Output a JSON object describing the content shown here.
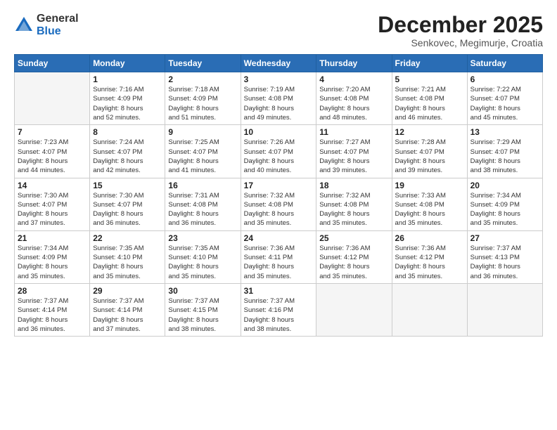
{
  "logo": {
    "general": "General",
    "blue": "Blue"
  },
  "title": "December 2025",
  "subtitle": "Senkovec, Megimurje, Croatia",
  "headers": [
    "Sunday",
    "Monday",
    "Tuesday",
    "Wednesday",
    "Thursday",
    "Friday",
    "Saturday"
  ],
  "weeks": [
    [
      {
        "num": "",
        "info": ""
      },
      {
        "num": "1",
        "info": "Sunrise: 7:16 AM\nSunset: 4:09 PM\nDaylight: 8 hours\nand 52 minutes."
      },
      {
        "num": "2",
        "info": "Sunrise: 7:18 AM\nSunset: 4:09 PM\nDaylight: 8 hours\nand 51 minutes."
      },
      {
        "num": "3",
        "info": "Sunrise: 7:19 AM\nSunset: 4:08 PM\nDaylight: 8 hours\nand 49 minutes."
      },
      {
        "num": "4",
        "info": "Sunrise: 7:20 AM\nSunset: 4:08 PM\nDaylight: 8 hours\nand 48 minutes."
      },
      {
        "num": "5",
        "info": "Sunrise: 7:21 AM\nSunset: 4:08 PM\nDaylight: 8 hours\nand 46 minutes."
      },
      {
        "num": "6",
        "info": "Sunrise: 7:22 AM\nSunset: 4:07 PM\nDaylight: 8 hours\nand 45 minutes."
      }
    ],
    [
      {
        "num": "7",
        "info": "Sunrise: 7:23 AM\nSunset: 4:07 PM\nDaylight: 8 hours\nand 44 minutes."
      },
      {
        "num": "8",
        "info": "Sunrise: 7:24 AM\nSunset: 4:07 PM\nDaylight: 8 hours\nand 42 minutes."
      },
      {
        "num": "9",
        "info": "Sunrise: 7:25 AM\nSunset: 4:07 PM\nDaylight: 8 hours\nand 41 minutes."
      },
      {
        "num": "10",
        "info": "Sunrise: 7:26 AM\nSunset: 4:07 PM\nDaylight: 8 hours\nand 40 minutes."
      },
      {
        "num": "11",
        "info": "Sunrise: 7:27 AM\nSunset: 4:07 PM\nDaylight: 8 hours\nand 39 minutes."
      },
      {
        "num": "12",
        "info": "Sunrise: 7:28 AM\nSunset: 4:07 PM\nDaylight: 8 hours\nand 39 minutes."
      },
      {
        "num": "13",
        "info": "Sunrise: 7:29 AM\nSunset: 4:07 PM\nDaylight: 8 hours\nand 38 minutes."
      }
    ],
    [
      {
        "num": "14",
        "info": "Sunrise: 7:30 AM\nSunset: 4:07 PM\nDaylight: 8 hours\nand 37 minutes."
      },
      {
        "num": "15",
        "info": "Sunrise: 7:30 AM\nSunset: 4:07 PM\nDaylight: 8 hours\nand 36 minutes."
      },
      {
        "num": "16",
        "info": "Sunrise: 7:31 AM\nSunset: 4:08 PM\nDaylight: 8 hours\nand 36 minutes."
      },
      {
        "num": "17",
        "info": "Sunrise: 7:32 AM\nSunset: 4:08 PM\nDaylight: 8 hours\nand 35 minutes."
      },
      {
        "num": "18",
        "info": "Sunrise: 7:32 AM\nSunset: 4:08 PM\nDaylight: 8 hours\nand 35 minutes."
      },
      {
        "num": "19",
        "info": "Sunrise: 7:33 AM\nSunset: 4:08 PM\nDaylight: 8 hours\nand 35 minutes."
      },
      {
        "num": "20",
        "info": "Sunrise: 7:34 AM\nSunset: 4:09 PM\nDaylight: 8 hours\nand 35 minutes."
      }
    ],
    [
      {
        "num": "21",
        "info": "Sunrise: 7:34 AM\nSunset: 4:09 PM\nDaylight: 8 hours\nand 35 minutes."
      },
      {
        "num": "22",
        "info": "Sunrise: 7:35 AM\nSunset: 4:10 PM\nDaylight: 8 hours\nand 35 minutes."
      },
      {
        "num": "23",
        "info": "Sunrise: 7:35 AM\nSunset: 4:10 PM\nDaylight: 8 hours\nand 35 minutes."
      },
      {
        "num": "24",
        "info": "Sunrise: 7:36 AM\nSunset: 4:11 PM\nDaylight: 8 hours\nand 35 minutes."
      },
      {
        "num": "25",
        "info": "Sunrise: 7:36 AM\nSunset: 4:12 PM\nDaylight: 8 hours\nand 35 minutes."
      },
      {
        "num": "26",
        "info": "Sunrise: 7:36 AM\nSunset: 4:12 PM\nDaylight: 8 hours\nand 35 minutes."
      },
      {
        "num": "27",
        "info": "Sunrise: 7:37 AM\nSunset: 4:13 PM\nDaylight: 8 hours\nand 36 minutes."
      }
    ],
    [
      {
        "num": "28",
        "info": "Sunrise: 7:37 AM\nSunset: 4:14 PM\nDaylight: 8 hours\nand 36 minutes."
      },
      {
        "num": "29",
        "info": "Sunrise: 7:37 AM\nSunset: 4:14 PM\nDaylight: 8 hours\nand 37 minutes."
      },
      {
        "num": "30",
        "info": "Sunrise: 7:37 AM\nSunset: 4:15 PM\nDaylight: 8 hours\nand 38 minutes."
      },
      {
        "num": "31",
        "info": "Sunrise: 7:37 AM\nSunset: 4:16 PM\nDaylight: 8 hours\nand 38 minutes."
      },
      {
        "num": "",
        "info": ""
      },
      {
        "num": "",
        "info": ""
      },
      {
        "num": "",
        "info": ""
      }
    ]
  ]
}
